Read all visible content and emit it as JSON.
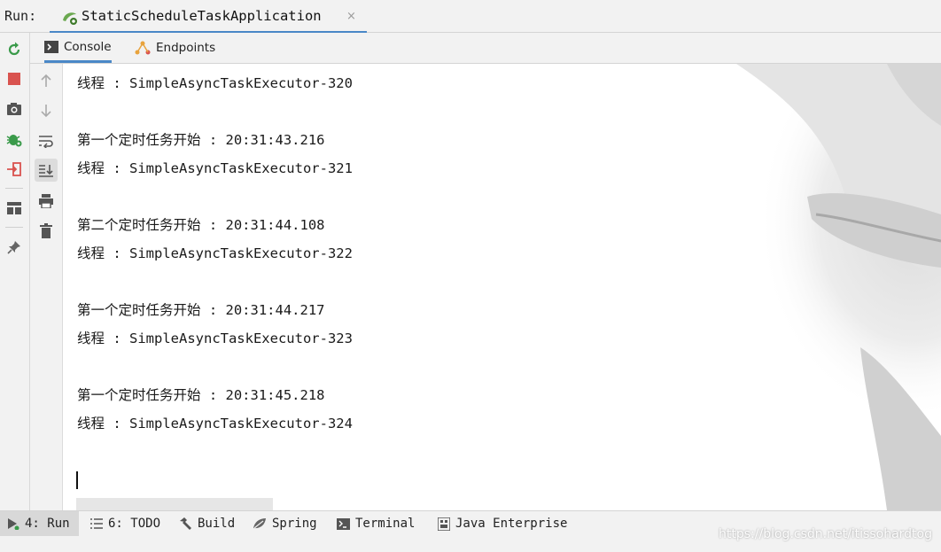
{
  "titlebar": {
    "run_label": "Run:",
    "app_tab_title": "StaticScheduleTaskApplication",
    "close_glyph": "×"
  },
  "left_toolbar": {
    "icons": [
      "rerun-icon",
      "stop-icon",
      "camera-icon",
      "debug-icon",
      "login-icon",
      "layout-icon",
      "pin-icon"
    ]
  },
  "subtabs": [
    {
      "label": "Console",
      "icon": "console-icon",
      "active": true
    },
    {
      "label": "Endpoints",
      "icon": "endpoints-icon",
      "active": false
    }
  ],
  "console": {
    "lines": [
      "线程 : SimpleAsyncTaskExecutor-320",
      "",
      "第一个定时任务开始 : 20:31:43.216",
      "线程 : SimpleAsyncTaskExecutor-321",
      "",
      "第二个定时任务开始 : 20:31:44.108",
      "线程 : SimpleAsyncTaskExecutor-322",
      "",
      "第一个定时任务开始 : 20:31:44.217",
      "线程 : SimpleAsyncTaskExecutor-323",
      "",
      "第一个定时任务开始 : 20:31:45.218",
      "线程 : SimpleAsyncTaskExecutor-324"
    ]
  },
  "bottom_tabs": [
    {
      "label": "4: Run",
      "icon": "run-icon",
      "active": true
    },
    {
      "label": "6: TODO",
      "icon": "todo-icon",
      "active": false
    },
    {
      "label": "Build",
      "icon": "hammer-icon",
      "active": false
    },
    {
      "label": "Spring",
      "icon": "spring-icon",
      "active": false
    },
    {
      "label": "Terminal",
      "icon": "terminal-icon",
      "active": false
    },
    {
      "label": "Java Enterprise",
      "icon": "java-enterprise-icon",
      "active": false
    }
  ],
  "watermark_credit": "https://blog.csdn.net/itissohardtog",
  "colors": {
    "accent": "#4a88c7",
    "rerun": "#3a9a4a",
    "stop": "#d9534f"
  }
}
